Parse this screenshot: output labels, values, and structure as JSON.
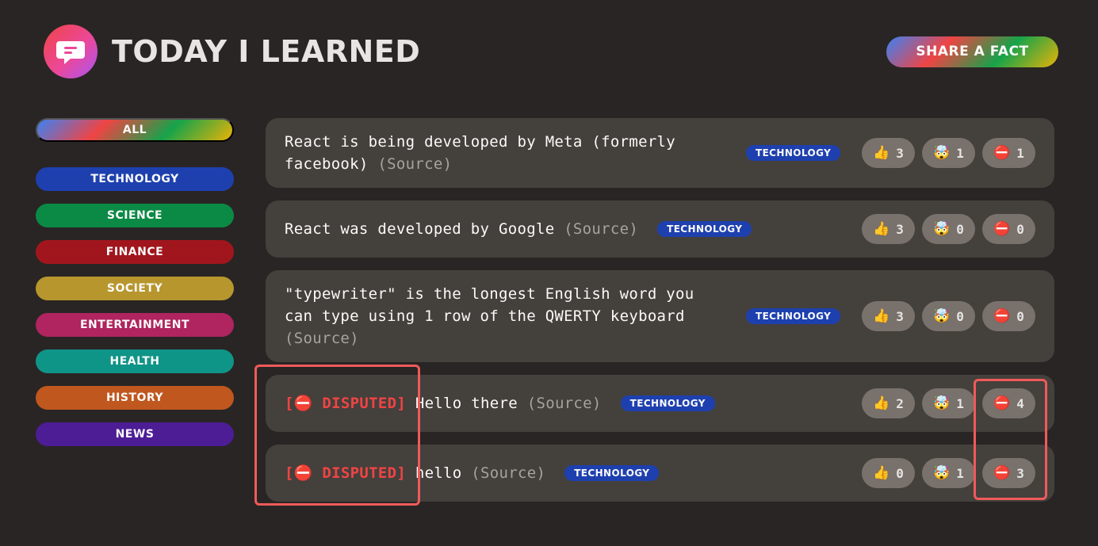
{
  "header": {
    "title": "TODAY I LEARNED",
    "share_label": "SHARE A FACT"
  },
  "sidebar": {
    "all_label": "ALL",
    "categories": [
      {
        "label": "TECHNOLOGY",
        "color": "#1e40af"
      },
      {
        "label": "SCIENCE",
        "color": "#0b8a45"
      },
      {
        "label": "FINANCE",
        "color": "#a1161d"
      },
      {
        "label": "SOCIETY",
        "color": "#b7962e"
      },
      {
        "label": "ENTERTAINMENT",
        "color": "#b0245f"
      },
      {
        "label": "HEALTH",
        "color": "#0f9488"
      },
      {
        "label": "HISTORY",
        "color": "#c0571e"
      },
      {
        "label": "NEWS",
        "color": "#4c1d95"
      }
    ]
  },
  "facts": [
    {
      "disputed_label": "",
      "text": "React is being developed by Meta (formerly facebook)",
      "source": "(Source)",
      "tag": "TECHNOLOGY",
      "votes": {
        "interesting": "3",
        "mindblowing": "1",
        "false": "1"
      }
    },
    {
      "disputed_label": "",
      "text": "React was developed by Google",
      "source": "(Source)",
      "tag": "TECHNOLOGY",
      "votes": {
        "interesting": "3",
        "mindblowing": "0",
        "false": "0"
      }
    },
    {
      "disputed_label": "",
      "text": "\"typewriter\" is the longest English word you can type using 1 row of the QWERTY keyboard",
      "source": "(Source)",
      "tag": "TECHNOLOGY",
      "votes": {
        "interesting": "3",
        "mindblowing": "0",
        "false": "0"
      }
    },
    {
      "disputed_label": "[⛔ DISPUTED]",
      "text": "Hello there",
      "source": "(Source)",
      "tag": "TECHNOLOGY",
      "votes": {
        "interesting": "2",
        "mindblowing": "1",
        "false": "4"
      }
    },
    {
      "disputed_label": "[⛔ DISPUTED]",
      "text": "hello",
      "source": "(Source)",
      "tag": "TECHNOLOGY",
      "votes": {
        "interesting": "0",
        "mindblowing": "1",
        "false": "3"
      }
    }
  ],
  "vote_icons": {
    "interesting": "👍",
    "mindblowing": "🤯",
    "false": "⛔"
  },
  "colors": {
    "background": "#292524",
    "card": "#44403c",
    "vote_button": "#78716c",
    "disputed": "#ef4444",
    "highlight": "#f05a5a"
  }
}
